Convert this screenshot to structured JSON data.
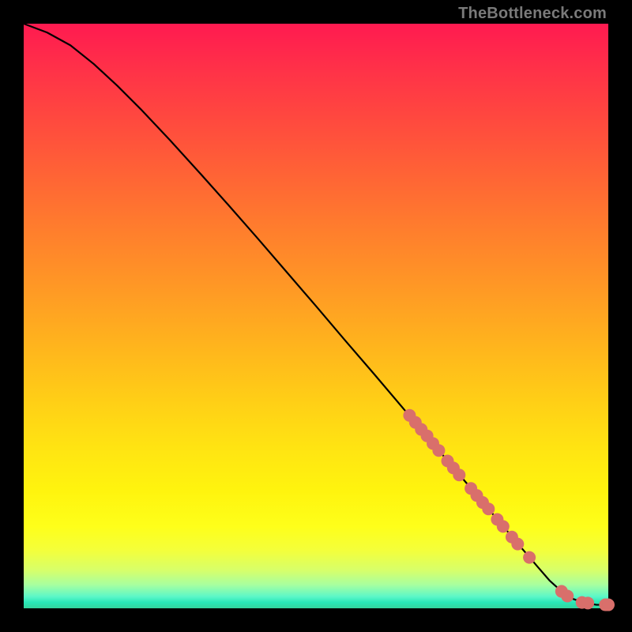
{
  "watermark": "TheBottleneck.com",
  "colors": {
    "curve": "#000000",
    "points": "#d96f6b",
    "frame": "#000000"
  },
  "chart_data": {
    "type": "line",
    "title": "",
    "xlabel": "",
    "ylabel": "",
    "xlim": [
      0,
      100
    ],
    "ylim": [
      0,
      100
    ],
    "grid": false,
    "legend": false,
    "series": [
      {
        "name": "curve",
        "x": [
          0,
          4,
          8,
          12,
          16,
          20,
          25,
          30,
          35,
          40,
          45,
          50,
          55,
          60,
          65,
          70,
          75,
          80,
          85,
          88,
          90,
          92,
          94,
          96,
          98,
          100
        ],
        "y": [
          100,
          98.5,
          96.3,
          93.1,
          89.4,
          85.4,
          80.1,
          74.6,
          69.0,
          63.3,
          57.5,
          51.7,
          45.8,
          40.0,
          34.1,
          28.2,
          22.3,
          16.4,
          10.5,
          7.0,
          4.7,
          2.9,
          1.6,
          0.9,
          0.6,
          0.6
        ]
      }
    ],
    "points": {
      "name": "highlighted-points",
      "x": [
        66,
        67,
        68,
        69,
        70,
        71,
        72.5,
        73.5,
        74.5,
        76.5,
        77.5,
        78.5,
        79.5,
        81,
        82,
        83.5,
        84.5,
        86.5,
        92,
        93,
        95.5,
        96.5,
        99.5,
        100
      ],
      "y": [
        33.0,
        31.8,
        30.6,
        29.5,
        28.2,
        27.0,
        25.2,
        24.0,
        22.8,
        20.5,
        19.3,
        18.1,
        17.0,
        15.2,
        14.0,
        12.2,
        11.0,
        8.7,
        2.9,
        2.1,
        1.0,
        0.9,
        0.6,
        0.6
      ]
    }
  }
}
